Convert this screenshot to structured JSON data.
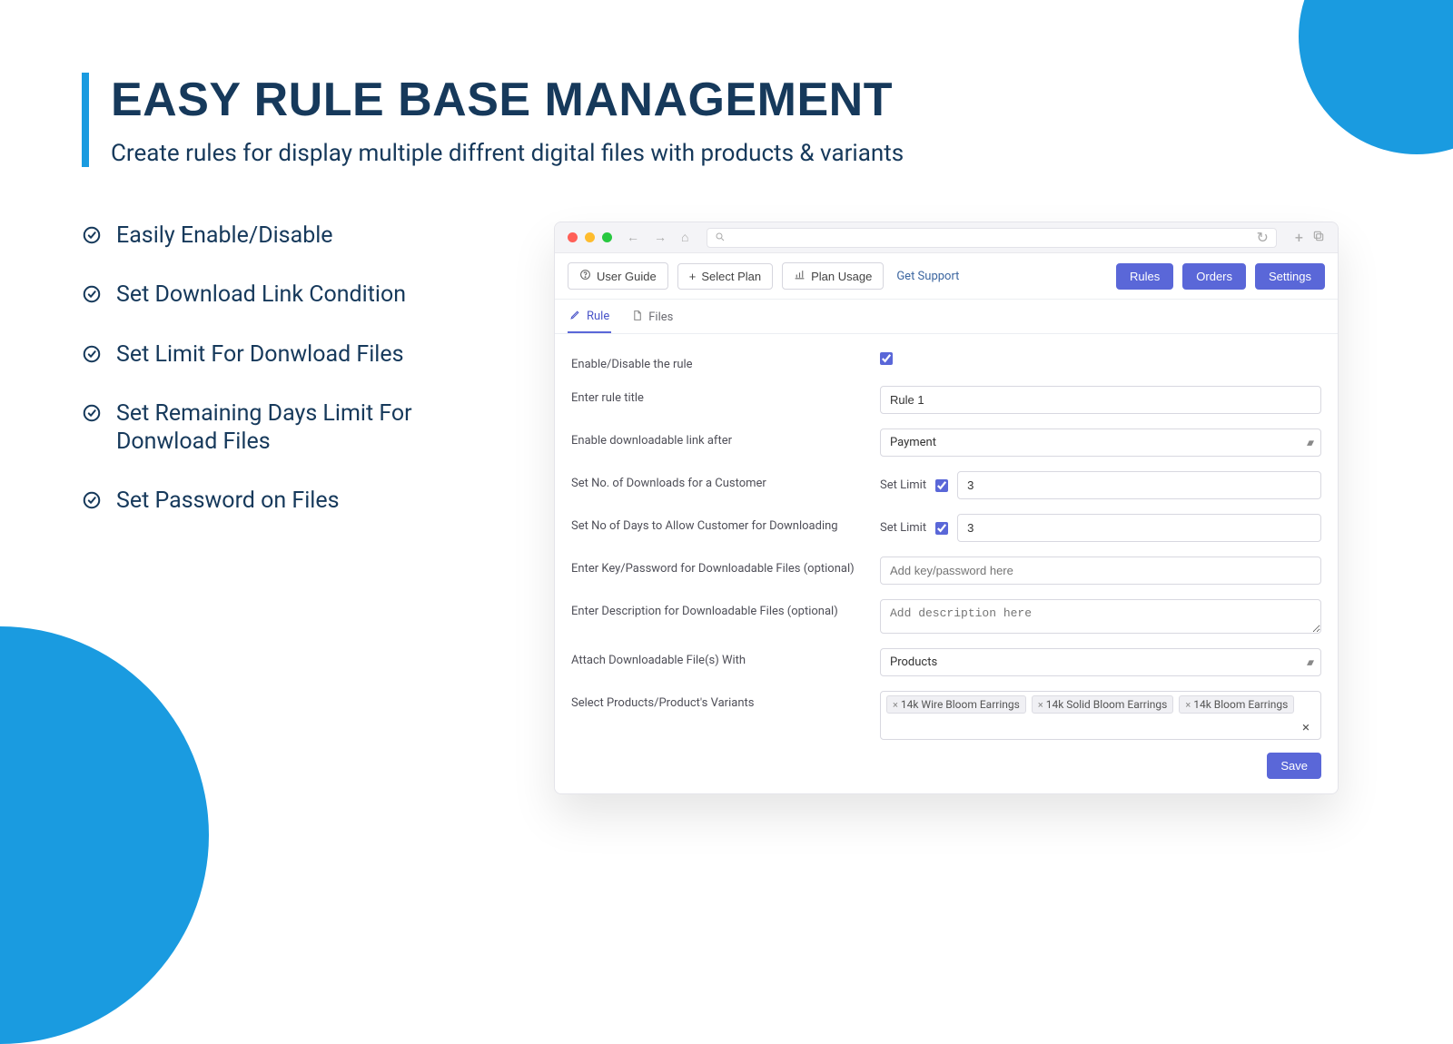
{
  "header": {
    "title": "EASY RULE BASE MANAGEMENT",
    "subtitle": "Create rules for display multiple diffrent digital files with products & variants"
  },
  "features": [
    "Easily Enable/Disable",
    "Set Download Link Condition",
    "Set Limit For Donwload Files",
    "Set Remaining Days Limit For Donwload Files",
    "Set Password on Files"
  ],
  "app": {
    "topbar": {
      "user_guide": "User Guide",
      "select_plan": "Select Plan",
      "plan_usage": "Plan Usage",
      "get_support": "Get Support",
      "rules": "Rules",
      "orders": "Orders",
      "settings": "Settings"
    },
    "tabs": {
      "rule": "Rule",
      "files": "Files"
    },
    "form": {
      "enable_label": "Enable/Disable the rule",
      "title_label": "Enter rule title",
      "title_value": "Rule 1",
      "link_after_label": "Enable downloadable link after",
      "link_after_value": "Payment",
      "downloads_label": "Set No. of Downloads for a Customer",
      "set_limit_text": "Set Limit",
      "downloads_value": "3",
      "days_label": "Set No of Days to Allow Customer for Downloading",
      "days_value": "3",
      "password_label": "Enter Key/Password for Downloadable Files (optional)",
      "password_placeholder": "Add key/password here",
      "description_label": "Enter Description for Downloadable Files (optional)",
      "description_placeholder": "Add description here",
      "attach_label": "Attach Downloadable File(s) With",
      "attach_value": "Products",
      "select_products_label": "Select Products/Product's Variants",
      "tags": [
        "14k Wire Bloom Earrings",
        "14k Solid Bloom Earrings",
        "14k Bloom Earrings"
      ],
      "clear_x": "×",
      "save_label": "Save"
    }
  }
}
